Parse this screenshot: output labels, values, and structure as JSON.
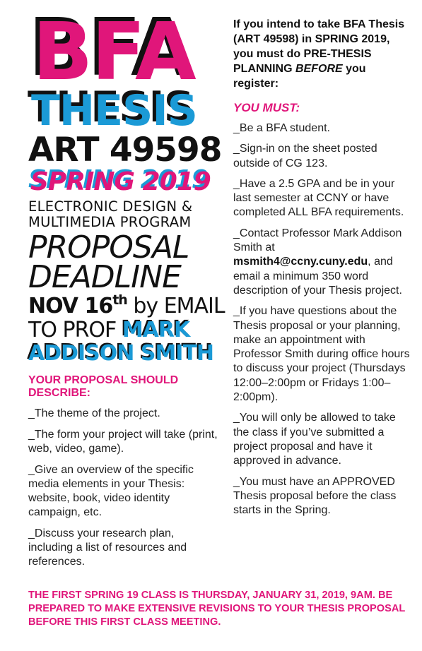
{
  "header": {
    "bfa": "BFA",
    "thesis": "THESIS",
    "course": "ART 49598",
    "term": "SPRING 2019",
    "program_line1": "ELECTRONIC DESIGN &",
    "program_line2": "MULTIMEDIA PROGRAM",
    "proposal": "PROPOSAL",
    "deadline": "DEADLINE",
    "date_main": "NOV 16",
    "date_suffix": "th",
    "by_email": " by EMAIL",
    "to_prof": "TO PROF ",
    "prof_first": "MARK",
    "prof_last": "ADDISON SMITH"
  },
  "describe": {
    "heading": "YOUR PROPOSAL SHOULD DESCRIBE:",
    "items": [
      "_The theme of the project.",
      "_The form your project will take (print, web, video, game).",
      "_Give an overview of the specific media elements in your Thesis: website, book, video identity campaign, etc.",
      "_Discuss your research plan, including a list of resources and references."
    ]
  },
  "right": {
    "intro_a": "If you intend to take BFA Thesis (ART 49598) in SPRING 2019, you must do PRE-THESIS PLANNING ",
    "intro_b": "BEFORE",
    "intro_c": " you register:",
    "must_heading": "YOU MUST:",
    "items": [
      "_Be a BFA student.",
      "_Sign-in on the sheet posted outside of CG 123.",
      "_Have a 2.5 GPA and be in your last semester at CCNY or have completed ALL BFA requirements."
    ],
    "contact_a": "_Contact Professor Mark Addison Smith at ",
    "contact_email": "msmith4@ccny.cuny.edu",
    "contact_b": ", and email a minimum 350 word description of your Thesis project.",
    "items2": [
      "_If you have questions about the Thesis proposal or your planning, make an appointment with Professor Smith during office hours to discuss your project (Thursdays 12:00–2:00pm or Fridays 1:00–2:00pm).",
      "_You will only be allowed to take the class if you’ve submitted a project proposal and have it approved in advance.",
      "_You must have an APPROVED Thesis proposal before the class starts in the Spring."
    ]
  },
  "footer": {
    "text": "THE FIRST SPRING 19 CLASS IS THURSDAY, JANUARY 31, 2019, 9AM. BE PREPARED TO MAKE EXTENSIVE REVISIONS TO YOUR THESIS PROPOSAL BEFORE THIS FIRST CLASS MEETING."
  },
  "colors": {
    "magenta": "#e0167a",
    "blue": "#1b9ad6",
    "black": "#111111"
  }
}
